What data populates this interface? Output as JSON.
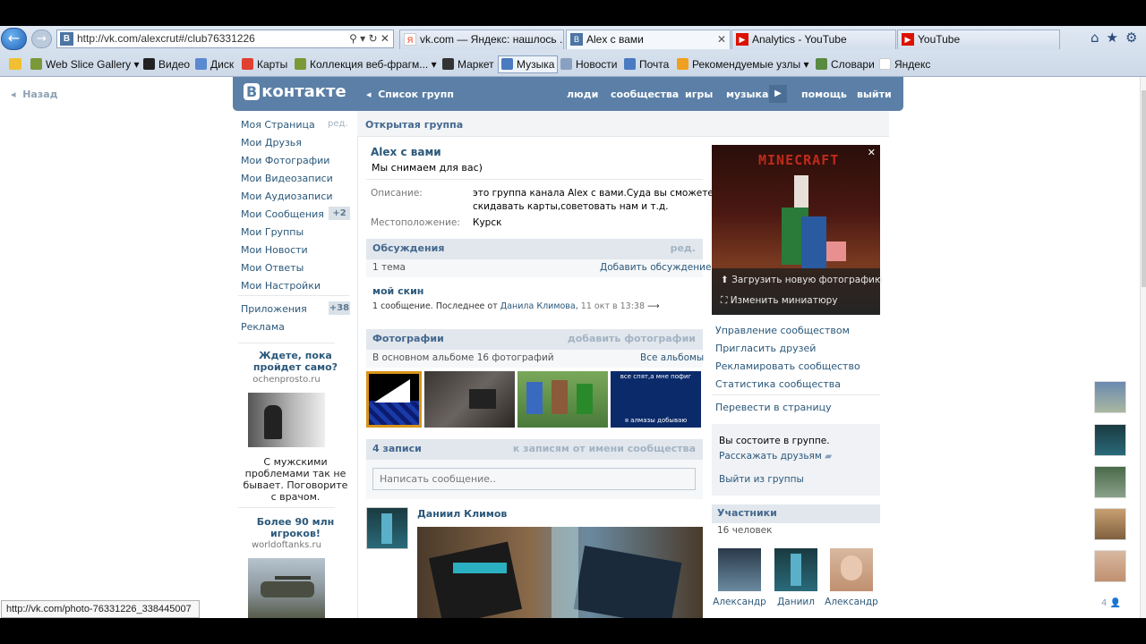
{
  "browser": {
    "address_url": "http://vk.com/alexcrut#/club76331226",
    "tabs": [
      {
        "label": "vk.com — Яндекс: нашлось ..."
      },
      {
        "label": "Alex с вами"
      },
      {
        "label": "Analytics - YouTube"
      },
      {
        "label": "YouTube"
      }
    ],
    "favorites": [
      "Web Slice Gallery",
      "Видео",
      "Диск",
      "Карты",
      "Коллекция веб-фрагм...",
      "Маркет",
      "Музыка",
      "Новости",
      "Почта",
      "Рекомендуемые узлы",
      "Словари",
      "Яндекс"
    ],
    "status_url": "http://vk.com/photo-76331226_338445007"
  },
  "page": {
    "back_label": "Назад",
    "logo_b": "В",
    "logo_text": "контакте",
    "groups_list": "Список групп",
    "header_links": [
      "люди",
      "сообщества",
      "игры",
      "музыка",
      "помощь",
      "выйти"
    ]
  },
  "leftnav": {
    "items": [
      "Моя Страница",
      "Мои Друзья",
      "Мои Фотографии",
      "Мои Видеозаписи",
      "Мои Аудиозаписи",
      "Мои Сообщения",
      "Мои Группы",
      "Мои Новости",
      "Мои Ответы",
      "Мои Настройки",
      "Приложения",
      "Реклама"
    ],
    "edit_label": "ред.",
    "messages_badge": "+2",
    "apps_badge": "+38"
  },
  "ads": [
    {
      "title": "Ждете, пока пройдет само?",
      "site": "ochenprosto.ru",
      "text": "С мужскими проблемами так не бывает. Поговорите с врачом."
    },
    {
      "title": "Более 90 млн игроков!",
      "site": "worldoftanks.ru"
    }
  ],
  "group": {
    "type": "Открытая группа",
    "name": "Alex с вами",
    "status": "Мы снимаем для вас)",
    "desc_label": "Описание:",
    "desc_line1": "это группа канала Alex с вами.Суда вы сможете",
    "desc_line2": "скидавать карты,советовать нам и т.д.",
    "loc_label": "Местоположение:",
    "loc_value": "Курск"
  },
  "discussions": {
    "title": "Обсуждения",
    "edit": "ред.",
    "count": "1 тема",
    "add": "Добавить обсуждение",
    "topic": "мой скин",
    "last_prefix": "1 сообщение. Последнее от",
    "last_author": "Данила Климова,",
    "last_time": "11 окт в 13:38"
  },
  "photos": {
    "title": "Фотографии",
    "add": "добавить фотографии",
    "count": "В основном альбоме 16 фотографий",
    "all": "Все альбомы",
    "thumb3_top": "все спят,а мне пофиг",
    "thumb3_bottom": "я алмазы добываю"
  },
  "wall": {
    "count": "4 записи",
    "owner_link": "к записям от имени сообщества",
    "placeholder": "Написать сообщение..",
    "post_author": "Даниил Климов"
  },
  "sidebar": {
    "banner_title": "MINECRAFT",
    "upload_photo": "Загрузить новую фотографию",
    "change_thumb": "Изменить миниатюру",
    "links": [
      "Управление сообществом",
      "Пригласить друзей",
      "Рекламировать сообщество",
      "Статистика сообщества"
    ],
    "to_page": "Перевести в страницу",
    "member_text": "Вы состоите в группе.",
    "tell_friends": "Расскажать друзьям",
    "leave": "Выйти из группы",
    "members_title": "Участники",
    "members_count": "16 человек",
    "members": [
      "Александр",
      "Даниил",
      "Александр"
    ]
  },
  "right_strip": {
    "count": "4"
  },
  "colors": {
    "vk_blue": "#5b7fa6",
    "link": "#2b587a"
  }
}
